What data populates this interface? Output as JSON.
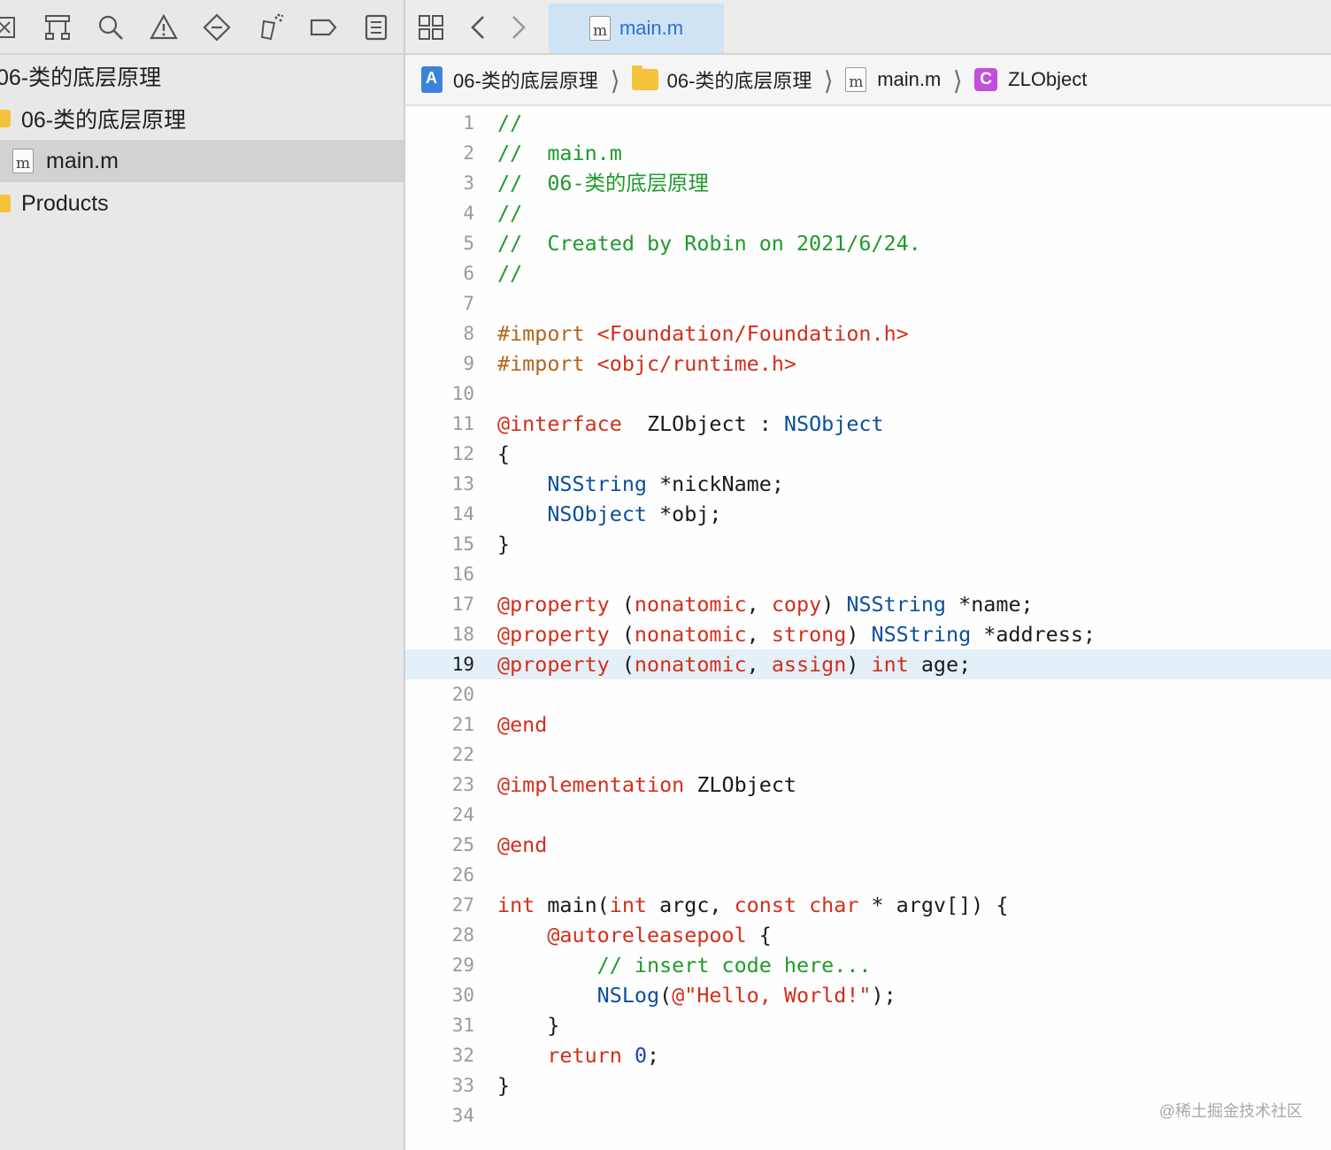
{
  "navigator": {
    "project_name": "06-类的底层原理",
    "items": [
      {
        "label": "06-类的底层原理",
        "kind": "folder"
      },
      {
        "label": "main.m",
        "kind": "file",
        "selected": true
      },
      {
        "label": "Products",
        "kind": "folder"
      }
    ],
    "toolbar_icons": [
      "project-navigator-icon",
      "source-control-icon",
      "find-icon",
      "issue-warning-icon",
      "test-icon",
      "debug-icon",
      "breakpoint-icon",
      "report-icon"
    ]
  },
  "editor": {
    "active_tab": "main.m",
    "breadcrumb": [
      "06-类的底层原理",
      "06-类的底层原理",
      "main.m",
      "ZLObject"
    ],
    "current_line": 19,
    "lines": [
      {
        "n": "1",
        "segs": [
          [
            "c-com",
            "//"
          ]
        ]
      },
      {
        "n": "2",
        "segs": [
          [
            "c-com",
            "//  main.m"
          ]
        ]
      },
      {
        "n": "3",
        "segs": [
          [
            "c-com",
            "//  06-类的底层原理"
          ]
        ]
      },
      {
        "n": "4",
        "segs": [
          [
            "c-com",
            "//"
          ]
        ]
      },
      {
        "n": "5",
        "segs": [
          [
            "c-com",
            "//  Created by Robin on 2021/6/24."
          ]
        ]
      },
      {
        "n": "6",
        "segs": [
          [
            "c-com",
            "//"
          ]
        ]
      },
      {
        "n": "7",
        "segs": []
      },
      {
        "n": "8",
        "segs": [
          [
            "c-pre",
            "#import "
          ],
          [
            "c-str",
            "<Foundation/Foundation.h>"
          ]
        ]
      },
      {
        "n": "9",
        "segs": [
          [
            "c-pre",
            "#import "
          ],
          [
            "c-str",
            "<objc/runtime.h>"
          ]
        ]
      },
      {
        "n": "10",
        "segs": []
      },
      {
        "n": "11",
        "segs": [
          [
            "c-kw",
            "@interface"
          ],
          [
            "",
            "  ZLObject : "
          ],
          [
            "c-typ",
            "NSObject"
          ]
        ]
      },
      {
        "n": "12",
        "segs": [
          [
            "",
            "{"
          ]
        ]
      },
      {
        "n": "13",
        "segs": [
          [
            "",
            "    "
          ],
          [
            "c-typ",
            "NSString"
          ],
          [
            "",
            " *nickName;"
          ]
        ]
      },
      {
        "n": "14",
        "segs": [
          [
            "",
            "    "
          ],
          [
            "c-typ",
            "NSObject"
          ],
          [
            "",
            " *obj;"
          ]
        ]
      },
      {
        "n": "15",
        "segs": [
          [
            "",
            "}"
          ]
        ]
      },
      {
        "n": "16",
        "segs": []
      },
      {
        "n": "17",
        "segs": [
          [
            "c-kw",
            "@property"
          ],
          [
            "",
            " ("
          ],
          [
            "c-kw",
            "nonatomic"
          ],
          [
            "",
            ", "
          ],
          [
            "c-kw",
            "copy"
          ],
          [
            "",
            ") "
          ],
          [
            "c-typ",
            "NSString"
          ],
          [
            "",
            " *name;"
          ]
        ]
      },
      {
        "n": "18",
        "segs": [
          [
            "c-kw",
            "@property"
          ],
          [
            "",
            " ("
          ],
          [
            "c-kw",
            "nonatomic"
          ],
          [
            "",
            ", "
          ],
          [
            "c-kw",
            "strong"
          ],
          [
            "",
            ") "
          ],
          [
            "c-typ",
            "NSString"
          ],
          [
            "",
            " *address;"
          ]
        ]
      },
      {
        "n": "19",
        "segs": [
          [
            "c-kw",
            "@property"
          ],
          [
            "",
            " ("
          ],
          [
            "c-kw",
            "nonatomic"
          ],
          [
            "",
            ", "
          ],
          [
            "c-kw",
            "assign"
          ],
          [
            "",
            ") "
          ],
          [
            "c-kw",
            "int"
          ],
          [
            "",
            " age;"
          ]
        ]
      },
      {
        "n": "20",
        "segs": []
      },
      {
        "n": "21",
        "segs": [
          [
            "c-kw",
            "@end"
          ]
        ]
      },
      {
        "n": "22",
        "segs": []
      },
      {
        "n": "23",
        "segs": [
          [
            "c-kw",
            "@implementation"
          ],
          [
            "",
            " ZLObject"
          ]
        ]
      },
      {
        "n": "24",
        "segs": []
      },
      {
        "n": "25",
        "segs": [
          [
            "c-kw",
            "@end"
          ]
        ]
      },
      {
        "n": "26",
        "segs": []
      },
      {
        "n": "27",
        "segs": [
          [
            "c-kw",
            "int"
          ],
          [
            "",
            " main("
          ],
          [
            "c-kw",
            "int"
          ],
          [
            "",
            " argc, "
          ],
          [
            "c-kw",
            "const"
          ],
          [
            "",
            " "
          ],
          [
            "c-kw",
            "char"
          ],
          [
            "",
            " * argv[]) {"
          ]
        ]
      },
      {
        "n": "28",
        "segs": [
          [
            "",
            "    "
          ],
          [
            "c-kw",
            "@autoreleasepool"
          ],
          [
            "",
            " {"
          ]
        ]
      },
      {
        "n": "29",
        "segs": [
          [
            "",
            "        "
          ],
          [
            "c-com",
            "// insert code here..."
          ]
        ]
      },
      {
        "n": "30",
        "segs": [
          [
            "",
            "        "
          ],
          [
            "c-typ",
            "NSLog"
          ],
          [
            "",
            "("
          ],
          [
            "c-str",
            "@\"Hello, World!\""
          ],
          [
            "",
            ");"
          ]
        ]
      },
      {
        "n": "31",
        "segs": [
          [
            "",
            "    }"
          ]
        ]
      },
      {
        "n": "32",
        "segs": [
          [
            "",
            "    "
          ],
          [
            "c-kw",
            "return"
          ],
          [
            "",
            " "
          ],
          [
            "c-num",
            "0"
          ],
          [
            "",
            ";"
          ]
        ]
      },
      {
        "n": "33",
        "segs": [
          [
            "",
            "}"
          ]
        ]
      },
      {
        "n": "34",
        "segs": []
      }
    ]
  },
  "watermark": "@稀土掘金技术社区"
}
